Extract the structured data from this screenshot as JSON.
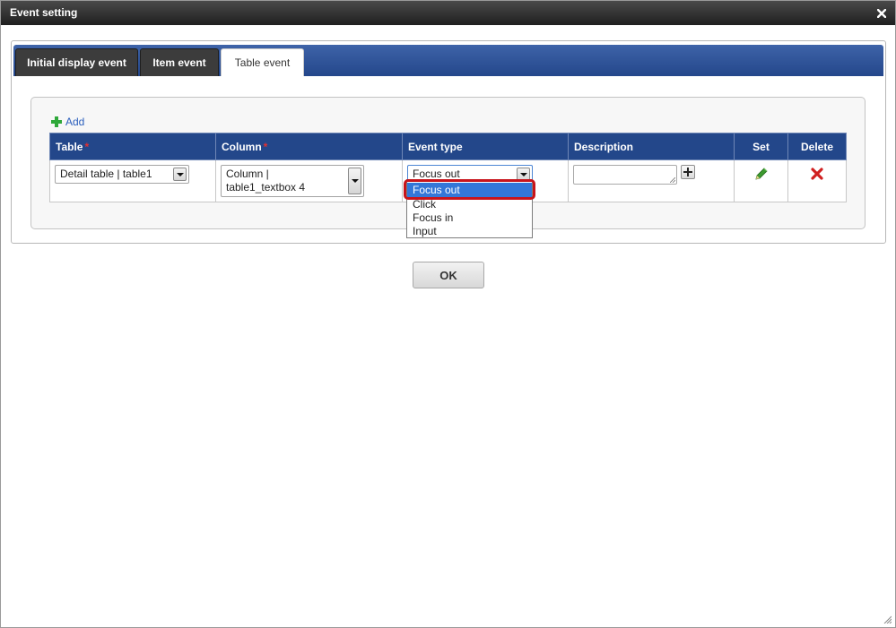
{
  "window": {
    "title": "Event setting",
    "close_icon": "close-icon"
  },
  "tabs": [
    {
      "label": "Initial display event",
      "active": false
    },
    {
      "label": "Item event",
      "active": false
    },
    {
      "label": "Table event",
      "active": true
    }
  ],
  "add_label": "Add",
  "table": {
    "headers": {
      "table": "Table",
      "column": "Column",
      "event_type": "Event type",
      "description": "Description",
      "set": "Set",
      "delete": "Delete"
    },
    "required_mark": "*",
    "row": {
      "table_value": "Detail table | table1",
      "column_value": "Column | table1_textbox 4",
      "event_type_value": "Focus out",
      "description_value": ""
    }
  },
  "event_type_options": [
    "Focus out",
    "Click",
    "Focus in",
    "Input"
  ],
  "ok_label": "OK",
  "colors": {
    "titlebar": "#2a2a2a",
    "tabbar": "#24478b",
    "header": "#23478a",
    "highlight": "#c8141b",
    "selected_option": "#3377d8",
    "add_plus": "#2fa83a",
    "edit_pencil": "#3c9a2f",
    "delete_x": "#d02020"
  }
}
